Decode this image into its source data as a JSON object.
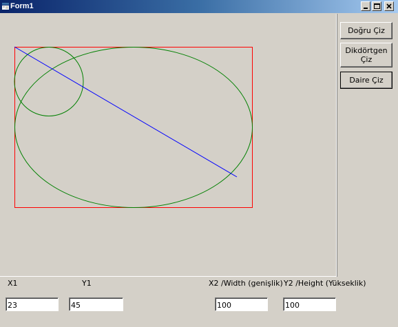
{
  "window": {
    "title": "Form1"
  },
  "buttons": {
    "line": "Doğru Çiz",
    "rect": "Dikdörtgen Çiz",
    "circle": "Daire Çiz"
  },
  "labels": {
    "x1": "X1",
    "y1": "Y1",
    "x2": "X2  /Width (genişlik)",
    "y2": "Y2  /Height (Yükseklik)"
  },
  "inputs": {
    "x1": "23",
    "y1": "45",
    "x2": "100",
    "y2": "100"
  },
  "colors": {
    "line": "#0000ff",
    "rectangle": "#ff0000",
    "ellipse": "#008000",
    "circle": "#008000"
  },
  "icons": {
    "app": "form-icon",
    "minimize": "minimize-icon",
    "maximize": "maximize-icon",
    "close": "close-icon"
  }
}
